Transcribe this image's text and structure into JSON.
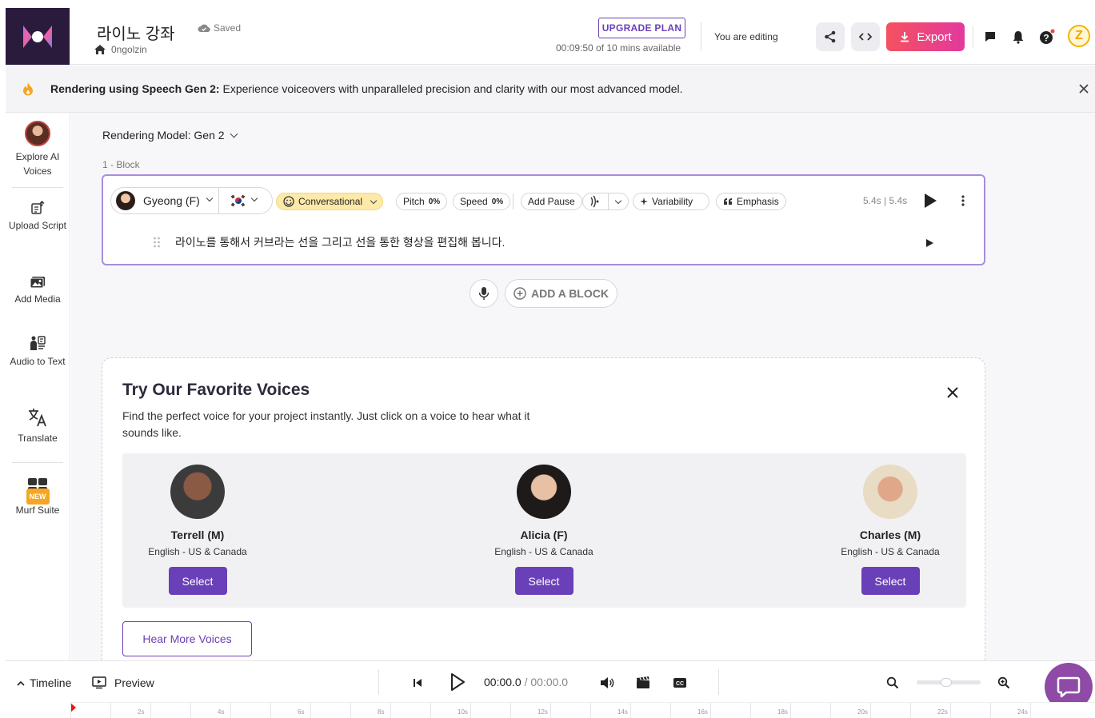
{
  "header": {
    "project_title": "라이노 강좌",
    "saved_status": "Saved",
    "workspace": "0ngolzin",
    "upgrade_label": "UPGRADE PLAN",
    "minutes_available": "00:09:50 of 10 mins available",
    "editing_status": "You are editing",
    "export_label": "Export",
    "user_initial": "Z"
  },
  "banner": {
    "bold_text": "Rendering using Speech Gen 2:",
    "text": " Experience voiceovers with unparalleled precision and clarity with our most advanced model."
  },
  "sidebar": {
    "items": [
      {
        "label": "Explore AI Voices",
        "icon": "voice-avatar-icon"
      },
      {
        "label": "Upload Script",
        "icon": "upload-script-icon"
      },
      {
        "label": "Add Media",
        "icon": "media-icon"
      },
      {
        "label": "Audio to Text",
        "icon": "audio-to-text-icon"
      },
      {
        "label": "Translate",
        "icon": "translate-icon"
      },
      {
        "label": "Murf Suite",
        "icon": "suite-icon",
        "badge": "NEW"
      }
    ]
  },
  "editor": {
    "rendering_model": "Rendering Model: Gen 2",
    "block_label": "1 -  Block",
    "voice_name": "Gyeong (F)",
    "style": "Conversational",
    "pitch_label": "Pitch",
    "pitch_value": "0%",
    "speed_label": "Speed",
    "speed_value": "0%",
    "add_pause": "Add Pause",
    "variability": "Variability",
    "emphasis": "Emphasis",
    "duration": "5.4s | 5.4s",
    "script_text": "라이노를 통해서 커브라는 선을 그리고 선을 통한 형상을 편집해 봅니다.",
    "add_block": "ADD A BLOCK"
  },
  "favorites": {
    "title": "Try Our Favorite Voices",
    "subtitle": "Find the perfect voice for your project instantly. Just click on a voice to hear what it sounds like.",
    "voices": [
      {
        "name": "Terrell (M)",
        "lang": "English - US & Canada",
        "select": "Select"
      },
      {
        "name": "Alicia (F)",
        "lang": "English - US & Canada",
        "select": "Select"
      },
      {
        "name": "Charles (M)",
        "lang": "English - US & Canada",
        "select": "Select"
      }
    ],
    "hear_more": "Hear More Voices"
  },
  "bottom": {
    "timeline": "Timeline",
    "preview": "Preview",
    "current_time": "00:00.0",
    "total_time": " / 00:00.0"
  },
  "ruler": {
    "labels": [
      "2s",
      "4s",
      "6s",
      "8s",
      "10s",
      "12s",
      "14s",
      "16s",
      "18s",
      "20s",
      "22s",
      "24s"
    ]
  },
  "colors": {
    "accent": "#6a40b8",
    "export_gradient_start": "#f5515f",
    "export_gradient_end": "#e2399e",
    "block_border": "#a98be0"
  }
}
